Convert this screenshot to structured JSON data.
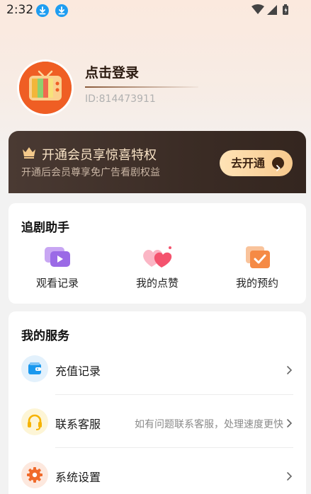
{
  "status_bar": {
    "time": "2:32",
    "icons": [
      "download-icon",
      "download-icon",
      "wifi-icon",
      "signal-icon",
      "battery-icon"
    ]
  },
  "profile": {
    "login_text": "点击登录",
    "user_id": "ID:814473911",
    "avatar_icon": "tv-icon"
  },
  "vip_banner": {
    "title": "开通会员享惊喜特权",
    "subtitle": "开通后会员尊享免广告看剧权益",
    "button_label": "去开通",
    "icon": "crown-icon"
  },
  "drama_helper": {
    "title": "追剧助手",
    "items": [
      {
        "label": "观看记录",
        "icon": "watch-history-icon"
      },
      {
        "label": "我的点赞",
        "icon": "likes-icon"
      },
      {
        "label": "我的预约",
        "icon": "reservations-icon"
      }
    ]
  },
  "my_services": {
    "title": "我的服务",
    "items": [
      {
        "label": "充值记录",
        "hint": "",
        "icon": "wallet-icon"
      },
      {
        "label": "联系客服",
        "hint": "如有问题联系客服，处理速度更快",
        "icon": "headset-icon"
      },
      {
        "label": "系统设置",
        "hint": "",
        "icon": "settings-icon"
      }
    ]
  },
  "colors": {
    "accent_orange": "#ef5e24",
    "vip_dark": "#3b2c25",
    "vip_gold": "#f7c98d",
    "download_blue": "#1e9df1"
  }
}
